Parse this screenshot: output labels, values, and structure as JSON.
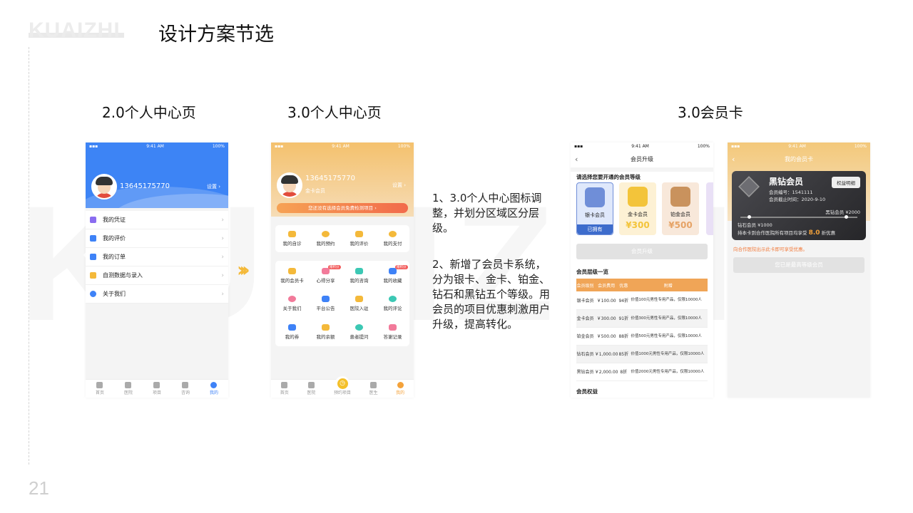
{
  "brand": "KUAIZHI",
  "title": "设计方案节选",
  "watermark": "KUAIZHI",
  "page_number": "21",
  "columns": [
    "2.0个人中心页",
    "3.0个人中心页",
    "3.0会员卡"
  ],
  "status_bar": {
    "time": "9:41 AM",
    "battery": "100%"
  },
  "v2": {
    "phone": "13645175770",
    "settings": "设置",
    "menu": [
      {
        "label": "我的凭证",
        "color": "#8a6cf0"
      },
      {
        "label": "我的评价",
        "color": "#3e82f7"
      },
      {
        "label": "我的订单",
        "color": "#3e82f7"
      },
      {
        "label": "自测数据与录入",
        "color": "#f4b93a"
      },
      {
        "label": "关于我们",
        "color": "#3e82f7"
      }
    ],
    "tabs": [
      "首页",
      "医院",
      "项目",
      "咨询",
      "我的"
    ]
  },
  "v3": {
    "phone": "13645175770",
    "level": "金卡会员",
    "settings": "设置",
    "banner": "您还没有选择会员免费检测项目",
    "row1": [
      {
        "label": "我的自诊",
        "color": "#f4b93a"
      },
      {
        "label": "我的预约",
        "color": "#f4b93a"
      },
      {
        "label": "我的评价",
        "color": "#f4b93a"
      },
      {
        "label": "我的支付",
        "color": "#f4b93a"
      }
    ],
    "grid": [
      {
        "label": "我的会员卡",
        "color": "#f4b93a",
        "badge": ""
      },
      {
        "label": "心得分享",
        "color": "#f27a9a",
        "badge": "赠积分"
      },
      {
        "label": "我的咨询",
        "color": "#3cc8b4",
        "badge": ""
      },
      {
        "label": "我的收藏",
        "color": "#3e82f7",
        "badge": "赠积分"
      },
      {
        "label": "关于我们",
        "color": "#f27a9a",
        "badge": ""
      },
      {
        "label": "平台公告",
        "color": "#3e82f7",
        "badge": ""
      },
      {
        "label": "医院入驻",
        "color": "#f4b93a",
        "badge": ""
      },
      {
        "label": "我的评论",
        "color": "#3cc8b4",
        "badge": ""
      },
      {
        "label": "我的券",
        "color": "#3e82f7",
        "badge": ""
      },
      {
        "label": "我的余额",
        "color": "#f4b93a",
        "badge": ""
      },
      {
        "label": "患者提问",
        "color": "#3cc8b4",
        "badge": ""
      },
      {
        "label": "答谢记录",
        "color": "#f27a9a",
        "badge": ""
      }
    ],
    "tabs": [
      "首页",
      "医院",
      "预约项目",
      "医生",
      "我的"
    ]
  },
  "desc": {
    "p1": "1、3.0个人中心图标调整，并划分区域区分层级。",
    "p2": "2、新增了会员卡系统，分为银卡、金卡、铂金、钻石和黑钻五个等级。用会员的项目优惠刺激用户升级，提高转化。"
  },
  "upgrade": {
    "nav_title": "会员升级",
    "prompt": "请选择您要开通的会员等级",
    "tiers": [
      {
        "name": "银卡会员",
        "price": "",
        "status": "已拥有",
        "color": "#6f8ed8"
      },
      {
        "name": "金卡会员",
        "price": "¥300",
        "status": "",
        "color": "#f3c43a"
      },
      {
        "name": "铂金会员",
        "price": "¥500",
        "status": "",
        "color": "#c9925d"
      }
    ],
    "button": "会员升级",
    "table_title": "会员层级一览",
    "headers": [
      "会员级别",
      "会员费用",
      "优惠",
      "附赠"
    ],
    "rows": [
      [
        "银卡会员",
        "￥100.00",
        "94折",
        "价值100元男性专用产品，仅限10000人"
      ],
      [
        "金卡会员",
        "￥300.00",
        "91折",
        "价值300元男性专用产品，仅限10000人"
      ],
      [
        "铂金会员",
        "￥500.00",
        "88折",
        "价值500元男性专用产品，仅限10000人"
      ],
      [
        "钻石会员",
        "￥1,000.00",
        "85折",
        "价值1000元男性专用产品，仅限10000人"
      ],
      [
        "黑钻会员",
        "￥2,000.00",
        "8折",
        "价值2000元男性专用产品，仅限10000人"
      ]
    ],
    "rights": "会员权益"
  },
  "mycard": {
    "nav_title": "我的会员卡",
    "level": "黑钻会员",
    "details_btn": "权益明细",
    "number": "会员编号：1541111",
    "expiry": "会员截止时间：2020-9-10",
    "next": "黑钻会员 ¥2000",
    "current": "钻石会员 ¥1000",
    "discount_prefix": "持本卡到合作医院所有项目均享受",
    "discount_value": "8.0",
    "discount_suffix": "折优惠",
    "note": "向合作医院出示此卡即可享受优惠。",
    "button": "您已是最高等级会员"
  }
}
